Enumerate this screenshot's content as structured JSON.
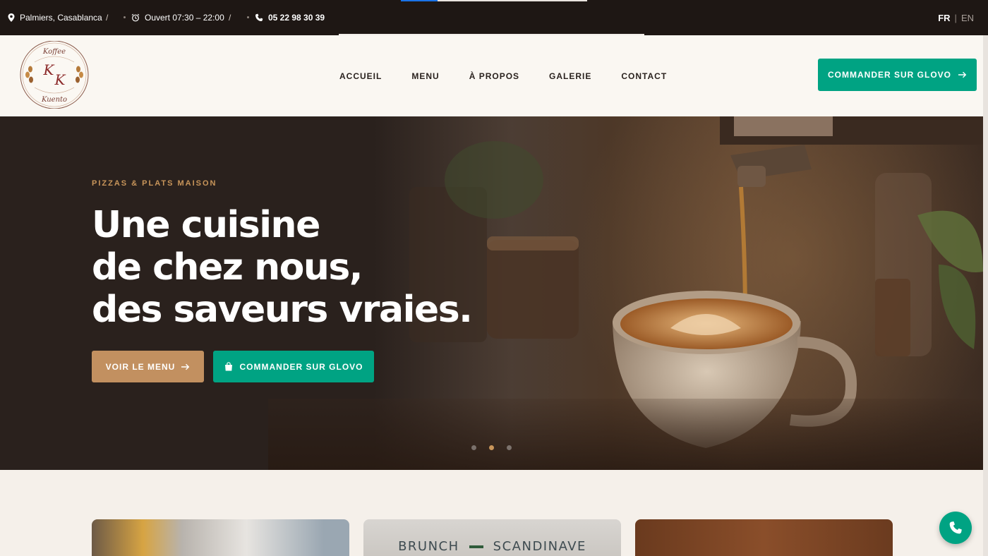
{
  "topbar": {
    "location": "Palmiers, Casablanca",
    "separator": "/",
    "hours": "Ouvert 07:30 – 22:00",
    "phone": "05 22 98 30 39",
    "lang_active": "FR",
    "lang_divider": "|",
    "lang_other": "EN"
  },
  "brand": {
    "logo_top": "Koffee",
    "logo_initials_1": "K",
    "logo_initials_2": "K",
    "logo_bottom": "Kuento"
  },
  "nav": {
    "items": [
      "ACCUEIL",
      "MENU",
      "À PROPOS",
      "GALERIE",
      "CONTACT"
    ]
  },
  "header": {
    "cta_label": "COMMANDER SUR GLOVO"
  },
  "hero": {
    "eyebrow": "PIZZAS & PLATS MAISON",
    "headline": [
      "Une cuisine",
      "de chez nous,",
      "des saveurs vraies."
    ],
    "btn_menu": "VOIR LE MENU",
    "btn_glovo": "COMMANDER SUR GLOVO"
  },
  "cards": {
    "card2_left": "BRUNCH",
    "card2_right": "SCANDINAVE"
  },
  "colors": {
    "accent_gold": "#c29060",
    "glovo_green": "#00a383",
    "dark_bg": "#1e1714"
  }
}
